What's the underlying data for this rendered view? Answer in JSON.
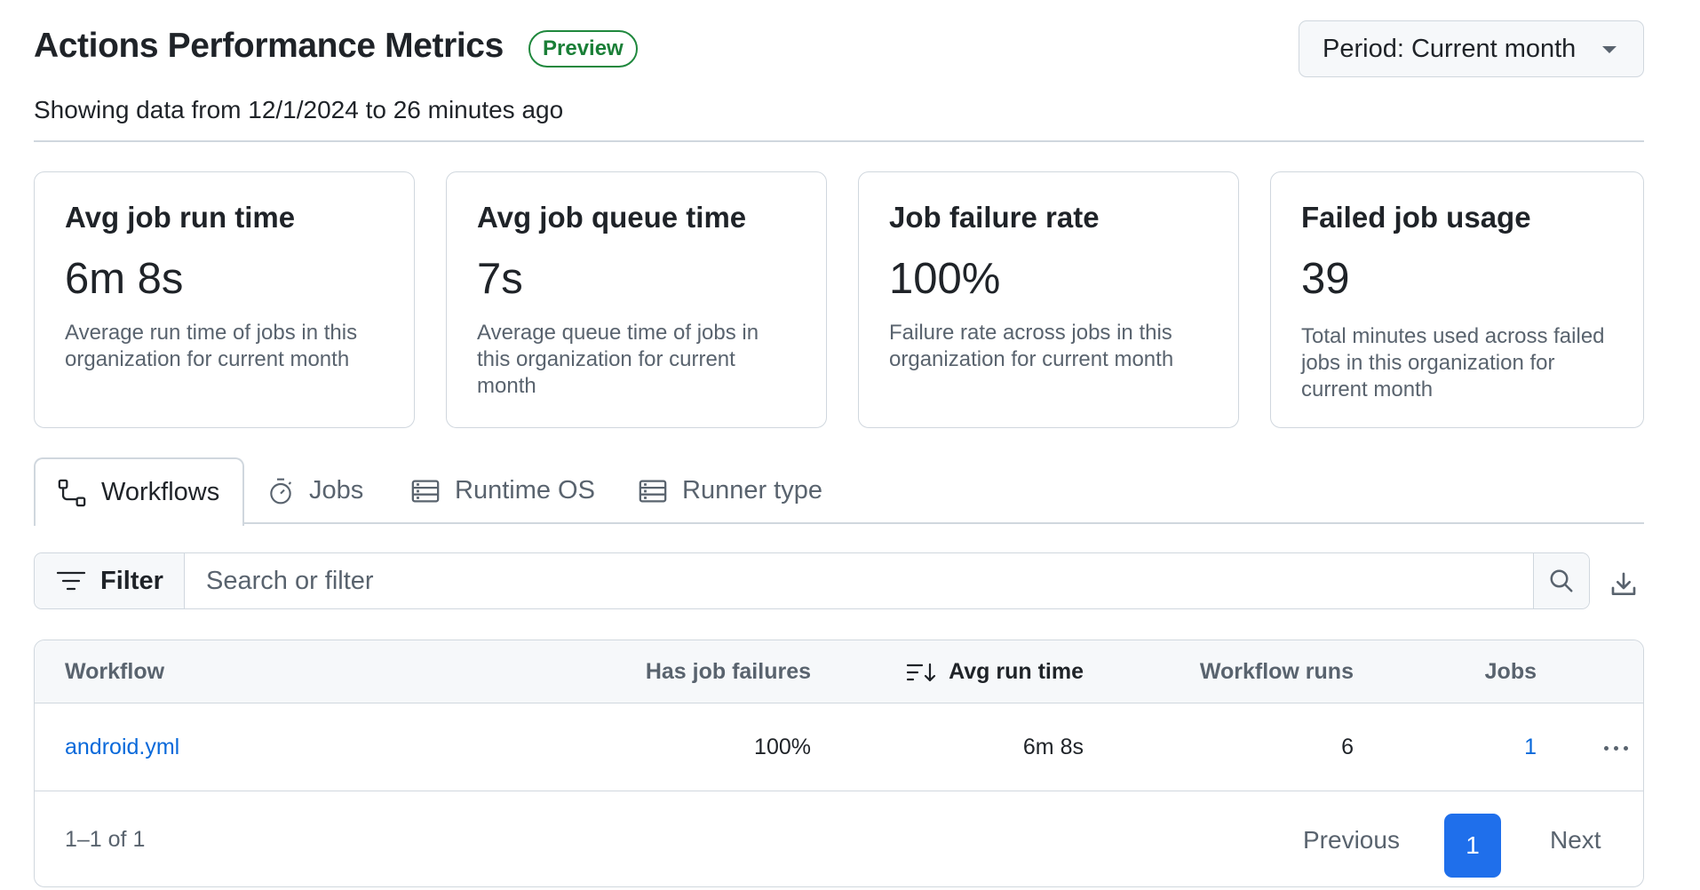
{
  "header": {
    "title": "Actions Performance Metrics",
    "badge": "Preview",
    "period_label": "Period: Current month",
    "subtitle": "Showing data from 12/1/2024 to 26 minutes ago"
  },
  "metrics": [
    {
      "title": "Avg job run time",
      "value": "6m 8s",
      "description": "Average run time of jobs in this organization for current month"
    },
    {
      "title": "Avg job queue time",
      "value": "7s",
      "description": "Average queue time of jobs in this organization for current month"
    },
    {
      "title": "Job failure rate",
      "value": "100%",
      "description": "Failure rate across jobs in this organization for current month"
    },
    {
      "title": "Failed job usage",
      "value": "39",
      "description": "Total minutes used across failed jobs in this organization for current month"
    }
  ],
  "tabs": [
    {
      "label": "Workflows",
      "icon": "workflow-icon",
      "active": true
    },
    {
      "label": "Jobs",
      "icon": "stopwatch-icon",
      "active": false
    },
    {
      "label": "Runtime OS",
      "icon": "server-icon",
      "active": false
    },
    {
      "label": "Runner type",
      "icon": "server-icon",
      "active": false
    }
  ],
  "filter": {
    "button_label": "Filter",
    "placeholder": "Search or filter",
    "value": ""
  },
  "table": {
    "columns": [
      "Workflow",
      "Has job failures",
      "Avg run time",
      "Workflow runs",
      "Jobs"
    ],
    "sorted_column": "Avg run time",
    "rows": [
      {
        "workflow": "android.yml",
        "has_job_failures": "100%",
        "avg_run_time": "6m 8s",
        "workflow_runs": "6",
        "jobs": "1"
      }
    ],
    "footer": {
      "range": "1–1 of 1",
      "previous": "Previous",
      "current_page": "1",
      "next": "Next"
    }
  },
  "colors": {
    "accent": "#1f6feb",
    "link": "#0969da",
    "badge_green": "#1a7f37",
    "border": "#d0d7de",
    "muted_text": "#59636e"
  }
}
